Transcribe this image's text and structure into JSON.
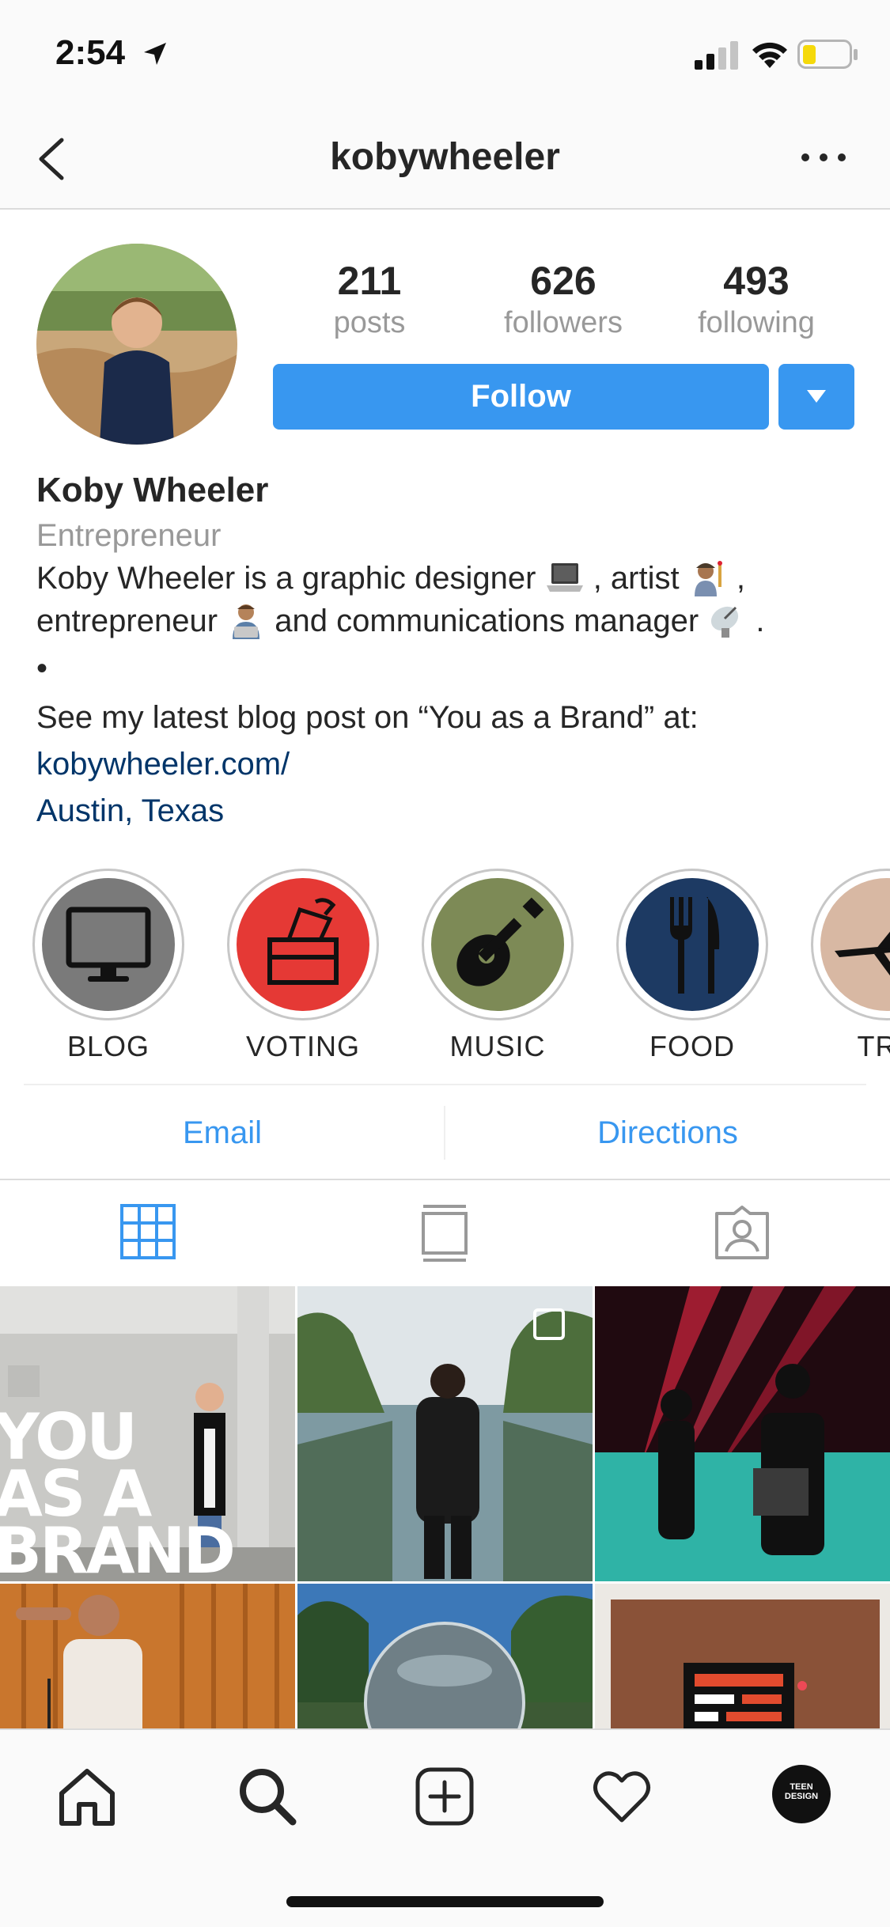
{
  "status_bar": {
    "time": "2:54"
  },
  "header": {
    "username": "kobywheeler"
  },
  "profile": {
    "stats": [
      {
        "value": "211",
        "label": "posts"
      },
      {
        "value": "626",
        "label": "followers"
      },
      {
        "value": "493",
        "label": "following"
      }
    ],
    "follow_label": "Follow",
    "full_name": "Koby Wheeler",
    "category": "Entrepreneur",
    "bio": {
      "line1_a": "Koby Wheeler is a graphic designer",
      "line1_b": ", artist",
      "line1_c": ",",
      "line2_a": "entrepreneur",
      "line2_b": "and communications manager",
      "line2_c": ".",
      "bullet": "•",
      "line4": "See my latest blog post on “You as a Brand” at:",
      "website": "kobywheeler.com/",
      "location": "Austin, Texas"
    }
  },
  "highlights": [
    {
      "label": "BLOG",
      "icon": "monitor-icon",
      "color": "#7a7a7a"
    },
    {
      "label": "VOTING",
      "icon": "ballot-box-icon",
      "color": "#e53935"
    },
    {
      "label": "MUSIC",
      "icon": "guitar-icon",
      "color": "#7d8a56"
    },
    {
      "label": "FOOD",
      "icon": "fork-knife-icon",
      "color": "#1d3a63"
    },
    {
      "label": "TRA",
      "icon": "airplane-icon",
      "color": "#d8b8a3"
    }
  ],
  "contact": {
    "email_label": "Email",
    "directions_label": "Directions"
  },
  "tabs": [
    "grid-icon",
    "feed-icon",
    "tagged-icon"
  ],
  "posts": [
    {
      "overlay_lines": [
        "YOU",
        "AS A",
        "BRAND"
      ]
    }
  ],
  "mini_avatar_text": [
    "TEEN",
    "DESIGN"
  ],
  "colors": {
    "accent": "#3897f0",
    "link": "#003569",
    "muted": "#999999"
  }
}
